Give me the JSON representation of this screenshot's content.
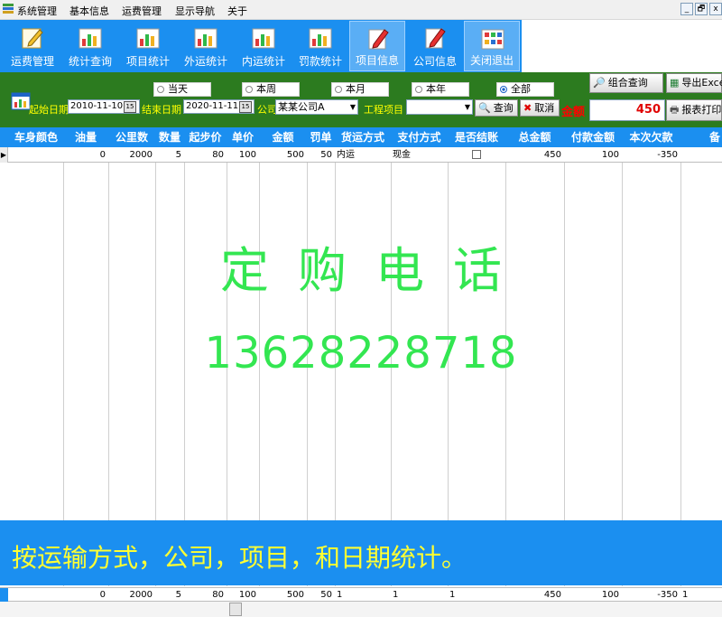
{
  "menu": [
    "系统管理",
    "基本信息",
    "运费管理",
    "显示导航",
    "关于"
  ],
  "window_buttons": [
    "_",
    "🗗",
    "x"
  ],
  "toolbar": [
    {
      "label": "运费管理",
      "icon": "pencil-note-icon"
    },
    {
      "label": "统计查询",
      "icon": "bar-chart-icon"
    },
    {
      "label": "项目统计",
      "icon": "bar-chart-icon"
    },
    {
      "label": "外运统计",
      "icon": "bar-chart-icon"
    },
    {
      "label": "内运统计",
      "icon": "bar-chart-icon"
    },
    {
      "label": "罚款统计",
      "icon": "bar-chart-icon"
    },
    {
      "label": "项目信息",
      "icon": "red-pencil-icon",
      "active": true
    },
    {
      "label": "公司信息",
      "icon": "red-pencil-icon"
    },
    {
      "label": "关闭退出",
      "icon": "app-grid-icon"
    }
  ],
  "filters": {
    "start_label": "起始日期",
    "start_value": "2010-11-10",
    "end_label": "结束日期",
    "end_value": "2020-11-11",
    "company_label": "公司",
    "company_value": "某某公司A",
    "project_label": "工程项目",
    "project_value": "",
    "calendar_btn": "15",
    "period_options": [
      {
        "label": "当天",
        "selected": false
      },
      {
        "label": "本周",
        "selected": false
      },
      {
        "label": "本月",
        "selected": false
      },
      {
        "label": "本年",
        "selected": false
      },
      {
        "label": "全部",
        "selected": true
      }
    ],
    "query_btn": "查询",
    "cancel_btn": "取消",
    "amount_label": "金额",
    "combo_query_btn": "组合查询",
    "export_btn": "导出Excel",
    "total_value": "450",
    "print_btn": "报表打印"
  },
  "grid": {
    "columns": [
      "车身颜色",
      "油量",
      "公里数",
      "数量",
      "起步价",
      "单价",
      "金额",
      "罚单",
      "货运方式",
      "支付方式",
      "是否结账",
      "总金额",
      "付款金额",
      "本次欠款",
      "备"
    ],
    "rows": [
      [
        "",
        "0",
        "2000",
        "5",
        "80",
        "100",
        "500",
        "50",
        "内运",
        "现金",
        "",
        "450",
        "100",
        "-350",
        ""
      ]
    ],
    "footer": [
      "",
      "0",
      "2000",
      "5",
      "80",
      "100",
      "500",
      "50",
      "1",
      "1",
      "1",
      "450",
      "100",
      "-350",
      "1"
    ]
  },
  "watermark": {
    "title": "定购电话",
    "phone": "13628228718"
  },
  "banner": "按运输方式，公司，项目，和日期统计。",
  "colors": {
    "toolbar_blue": "#1b8ff0",
    "filter_green": "#2c7b1f",
    "watermark_green": "#33e651",
    "banner_text": "#ffff33"
  }
}
